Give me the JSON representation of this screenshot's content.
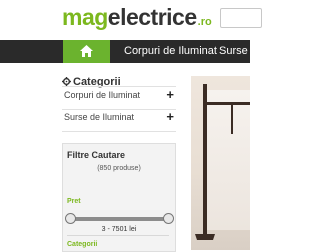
{
  "logo": {
    "part1": "mag",
    "part2": "electrice",
    "tld": ".ro"
  },
  "nav": {
    "home_icon": "home-icon",
    "items": [
      {
        "label": "Corpuri de Iluminat"
      },
      {
        "label": "Surse de"
      }
    ]
  },
  "categories": {
    "title": "Categorii",
    "icon": "gear-icon",
    "items": [
      {
        "label": "Corpuri de Iluminat"
      },
      {
        "label": "Surse de Iluminat"
      }
    ]
  },
  "filter": {
    "title": "Filtre Cautare",
    "count": "(850 produse)",
    "price_label": "Pret",
    "price_range": "3 - 7501 lei",
    "categories_label": "Categorii"
  },
  "colors": {
    "brand_green": "#7cb81f",
    "nav_dark": "#2a2a2a",
    "home_green": "#6bb32e"
  }
}
